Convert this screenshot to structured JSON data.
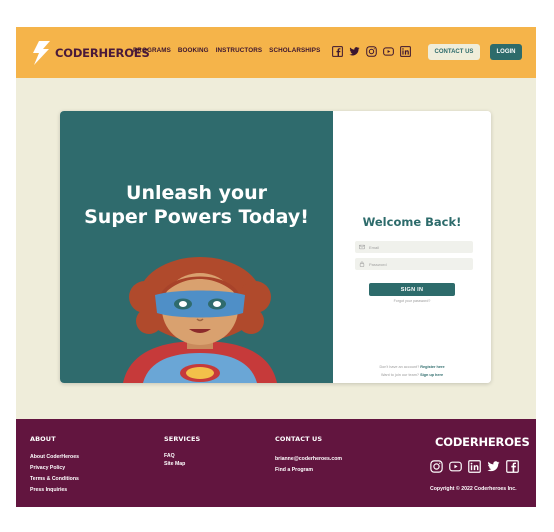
{
  "header": {
    "logo_text": "CODERHEROES",
    "nav": [
      "PROGRAMS",
      "BOOKING",
      "INSTRUCTORS",
      "SCHOLARSHIPS"
    ],
    "social_icons": [
      "facebook-icon",
      "twitter-icon",
      "instagram-icon",
      "youtube-icon",
      "linkedin-icon"
    ],
    "contact_label": "CONTACT US",
    "login_label": "LOGIN"
  },
  "hero": {
    "title_line1": "Unleash your",
    "title_line2": "Super Powers Today!"
  },
  "login": {
    "title": "Welcome Back!",
    "email_placeholder": "Email",
    "password_placeholder": "Password",
    "signin_label": "SIGN IN",
    "forgot_label": "Forgot your password?",
    "no_account_text": "Don't have an account?",
    "register_link": "Register here",
    "teach_text": "Want to join our team?",
    "signup_link": "Sign up here"
  },
  "footer": {
    "about": {
      "heading": "ABOUT",
      "links": [
        "About CoderHeroes",
        "Privacy Policy",
        "Terms & Conditions",
        "Press Inquiries"
      ]
    },
    "services": {
      "heading": "SERVICES",
      "links": [
        "FAQ",
        "Site Map"
      ]
    },
    "contact": {
      "heading": "CONTACT US",
      "email": "brianne@coderheroes.com",
      "find_program": "Find a Program"
    },
    "logo_text": "CODERHEROES",
    "social_icons": [
      "instagram-icon",
      "youtube-icon",
      "linkedin-icon",
      "twitter-icon",
      "facebook-icon"
    ],
    "copyright": "Copyright © 2022 Coderheroes Inc."
  },
  "colors": {
    "header_bg": "#f5b44a",
    "page_bg": "#efedda",
    "teal": "#2d6b6b",
    "footer_bg": "#62153f"
  }
}
